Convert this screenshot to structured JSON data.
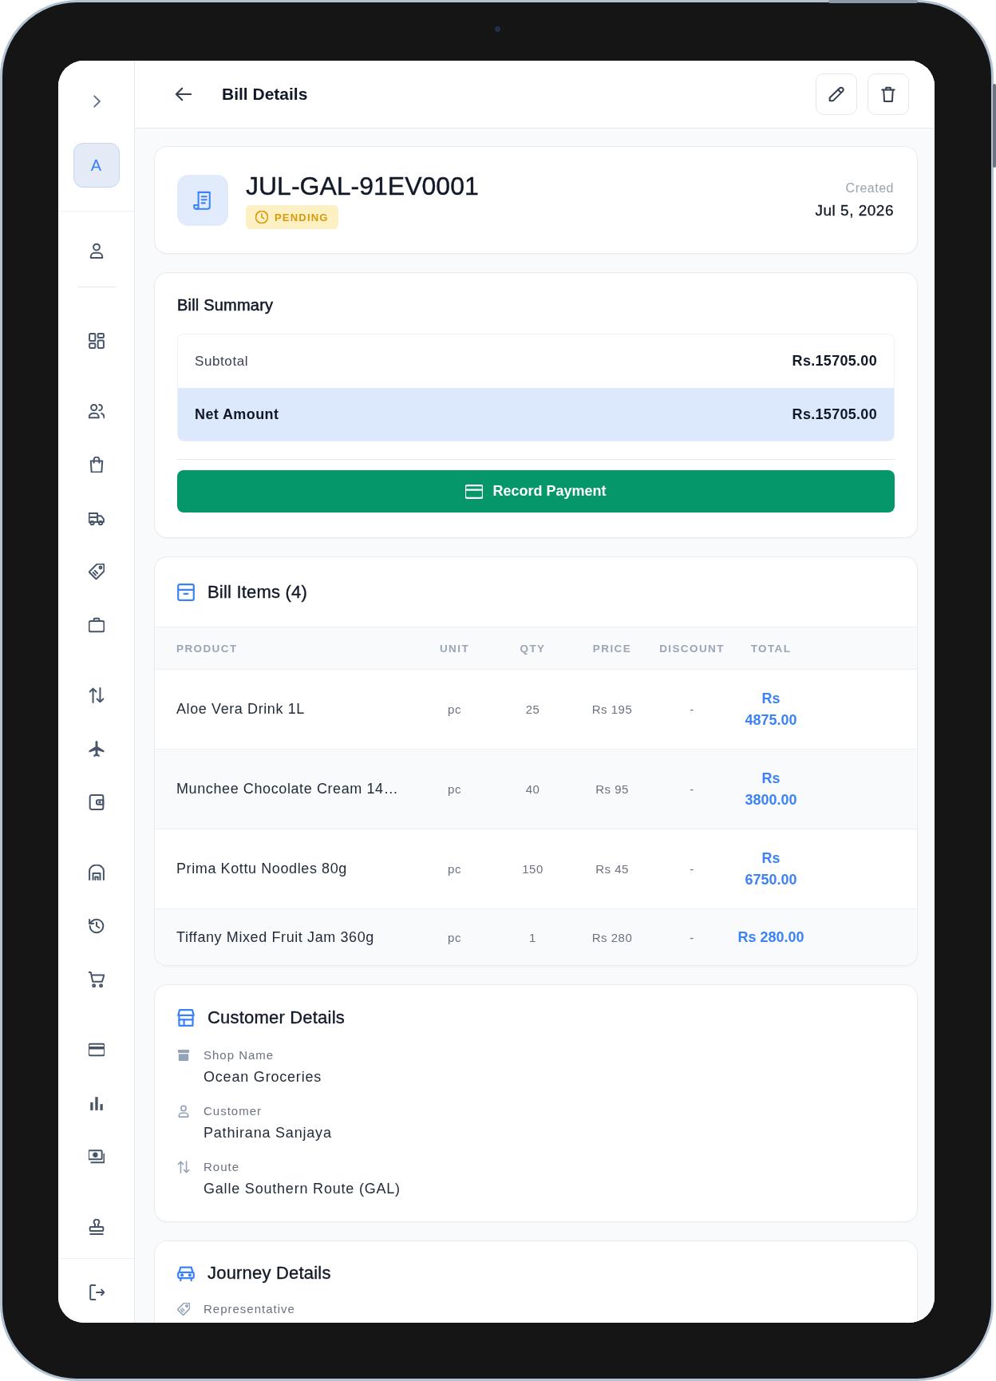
{
  "sidebar": {
    "avatar": "A"
  },
  "header": {
    "title": "Bill Details"
  },
  "bill": {
    "number": "JUL-GAL-91EV0001",
    "status": {
      "kind": "pending",
      "label": "PENDING"
    },
    "created_label": "Created",
    "created_date": "Jul 5, 2026"
  },
  "summary": {
    "title": "Bill Summary",
    "rows": [
      {
        "kind": "line",
        "label": "Subtotal",
        "value": "Rs.15705.00"
      },
      {
        "kind": "net",
        "label": "Net Amount",
        "value": "Rs.15705.00"
      }
    ],
    "action": "Record Payment"
  },
  "items": {
    "title": "Bill Items (4)",
    "columns": [
      "PRODUCT",
      "UNIT",
      "QTY",
      "PRICE",
      "DISCOUNT",
      "TOTAL"
    ],
    "rows": [
      {
        "product": "Aloe Vera Drink 1L",
        "unit": "pc",
        "qty": "25",
        "price": "Rs 195",
        "discount": "-",
        "total": "Rs 4875.00"
      },
      {
        "product": "Munchee Chocolate Cream 14…",
        "unit": "pc",
        "qty": "40",
        "price": "Rs 95",
        "discount": "-",
        "total": "Rs 3800.00"
      },
      {
        "product": "Prima Kottu Noodles 80g",
        "unit": "pc",
        "qty": "150",
        "price": "Rs 45",
        "discount": "-",
        "total": "Rs 6750.00"
      },
      {
        "product": "Tiffany Mixed Fruit Jam 360g",
        "unit": "pc",
        "qty": "1",
        "price": "Rs 280",
        "discount": "-",
        "total": "Rs 280.00"
      }
    ]
  },
  "customer": {
    "title": "Customer Details",
    "fields": [
      {
        "kind": "shop",
        "label": "Shop Name",
        "value": "Ocean Groceries"
      },
      {
        "kind": "person",
        "label": "Customer",
        "value": "Pathirana Sanjaya"
      },
      {
        "kind": "route",
        "label": "Route",
        "value": "Galle Southern Route (GAL)"
      }
    ]
  },
  "journey": {
    "title": "Journey Details",
    "fields": [
      {
        "kind": "representative",
        "label": "Representative"
      }
    ]
  }
}
